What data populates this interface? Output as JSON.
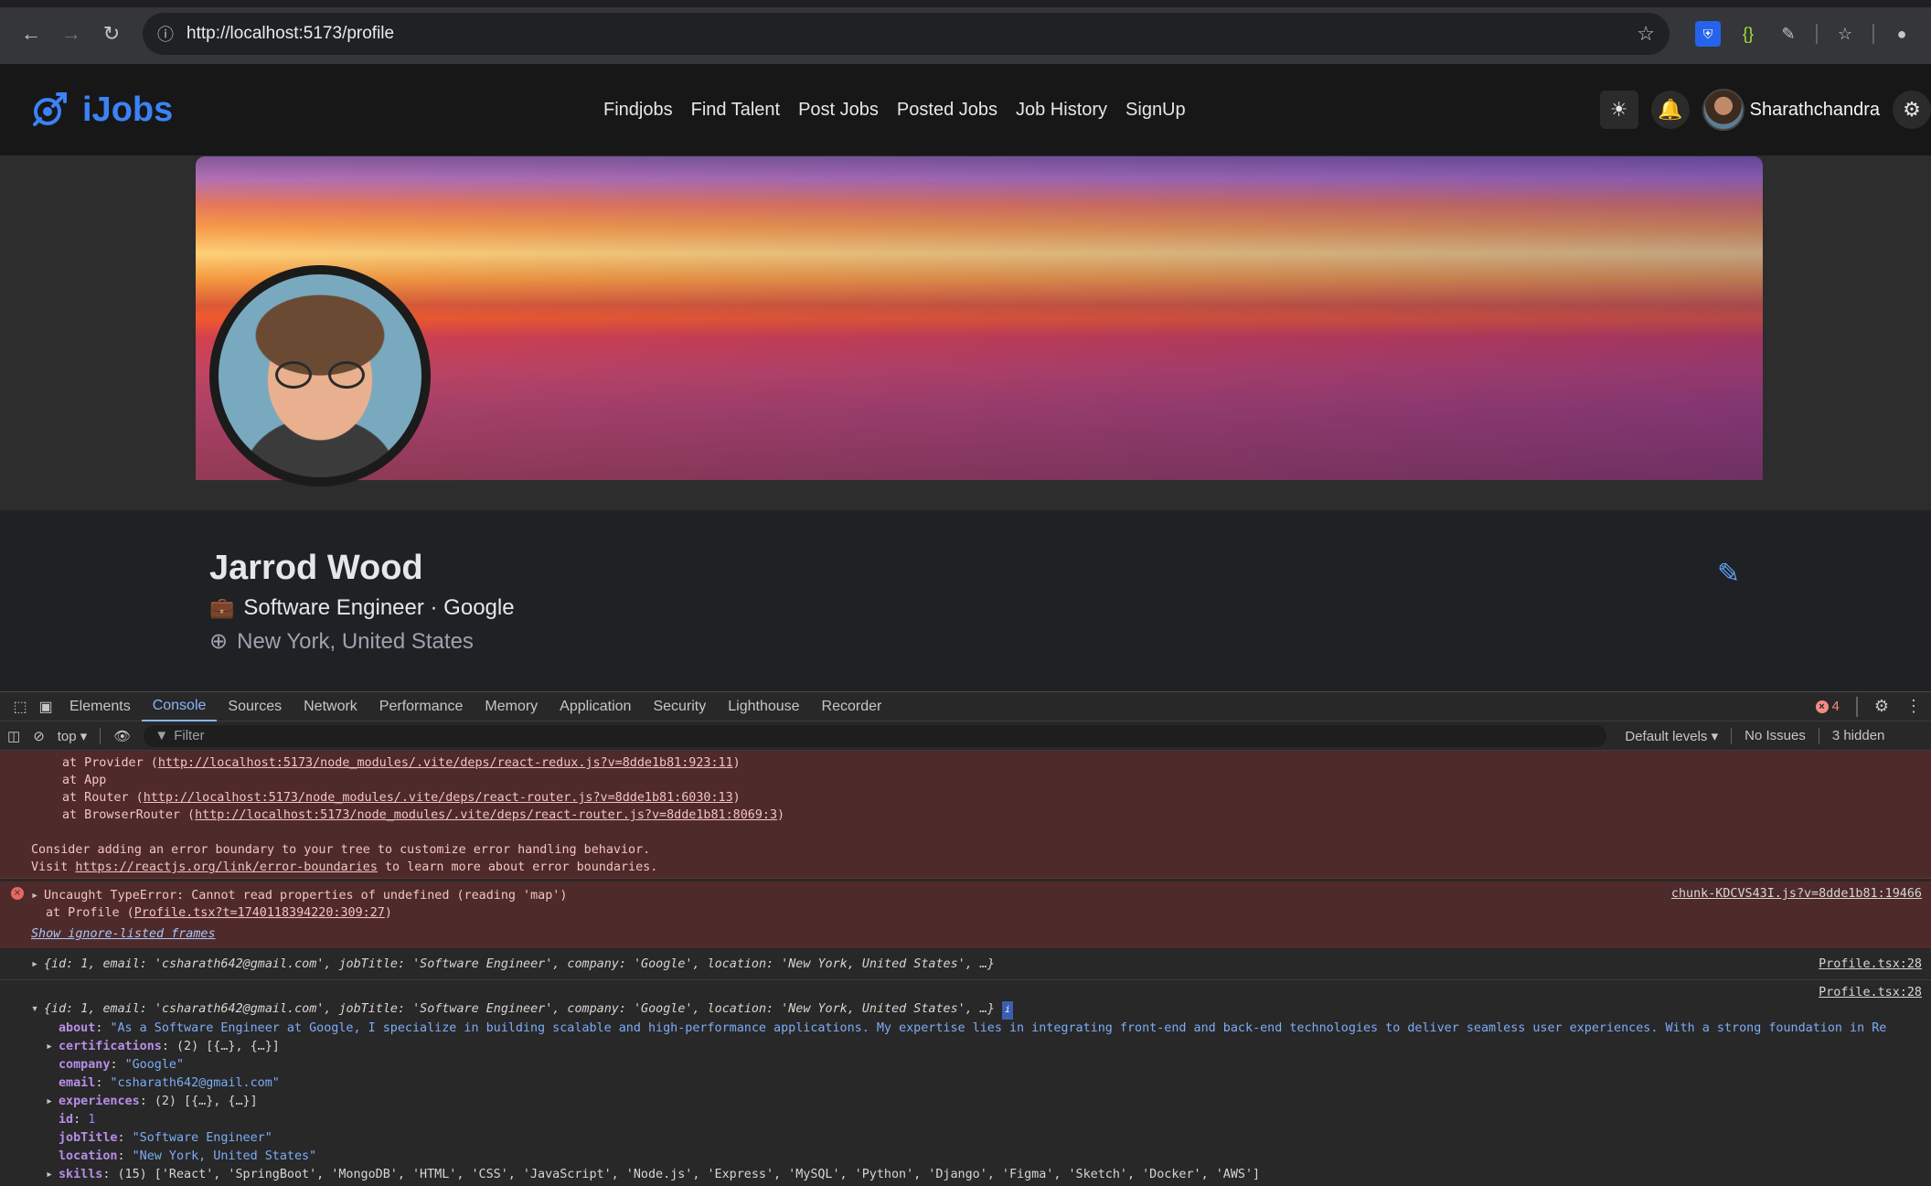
{
  "browser": {
    "url": "http://localhost:5173/profile"
  },
  "header": {
    "brand": "iJobs",
    "nav": [
      "Findjobs",
      "Find Talent",
      "Post Jobs",
      "Posted Jobs",
      "Job History",
      "SignUp"
    ],
    "username": "Sharathchandra"
  },
  "profile": {
    "name": "Jarrod Wood",
    "title_line": "Software Engineer · Google",
    "location": "New York, United States"
  },
  "devtools": {
    "tabs": [
      "Elements",
      "Console",
      "Sources",
      "Network",
      "Performance",
      "Memory",
      "Application",
      "Security",
      "Lighthouse",
      "Recorder"
    ],
    "active_tab": "Console",
    "error_count": "4",
    "context": "top",
    "filter_placeholder": "Filter",
    "levels": "Default levels",
    "issues": "No Issues",
    "hidden": "3 hidden"
  },
  "console": {
    "stack1": [
      "at Provider (",
      "http://localhost:5173/node_modules/.vite/deps/react-redux.js?v=8dde1b81:923:11",
      "at App",
      "at Router (",
      "http://localhost:5173/node_modules/.vite/deps/react-router.js?v=8dde1b81:6030:13",
      "at BrowserRouter (",
      "http://localhost:5173/node_modules/.vite/deps/react-router.js?v=8dde1b81:8069:3"
    ],
    "consider": "Consider adding an error boundary to your tree to customize error handling behavior.",
    "visit_prefix": "Visit ",
    "visit_link": "https://reactjs.org/link/error-boundaries",
    "visit_suffix": " to learn more about error boundaries.",
    "error2": "Uncaught TypeError: Cannot read properties of undefined (reading 'map')",
    "error2_src": "chunk-KDCVS43I.js?v=8dde1b81:19466",
    "error2_at": "at Profile (",
    "error2_at_link": "Profile.tsx?t=1740118394220:309:27",
    "ignore_frames": "Show ignore-listed frames",
    "log1_src": "Profile.tsx:28",
    "log2_src": "Profile.tsx:28",
    "log_summary_1": "{id: 1, email: 'csharath642@gmail.com', jobTitle: 'Software Engineer', company: 'Google', location: 'New York, United States', …}",
    "log_summary_2": "{id: 1, email: 'csharath642@gmail.com', jobTitle: 'Software Engineer', company: 'Google', location: 'New York, United States', …}",
    "props": [
      {
        "key": "about",
        "value": "\"As a Software Engineer at Google, I specialize in building scalable and high-performance applications. My expertise lies in integrating front-end and back-end technologies to deliver seamless user experiences. With a strong foundation in Re",
        "expandable": false
      },
      {
        "key": "certifications",
        "value": "(2) [{…}, {…}]",
        "expandable": true
      },
      {
        "key": "company",
        "value": "\"Google\"",
        "expandable": false
      },
      {
        "key": "email",
        "value": "\"csharath642@gmail.com\"",
        "expandable": false
      },
      {
        "key": "experiences",
        "value": "(2) [{…}, {…}]",
        "expandable": true
      },
      {
        "key": "id",
        "value": "1",
        "expandable": false
      },
      {
        "key": "jobTitle",
        "value": "\"Software Engineer\"",
        "expandable": false
      },
      {
        "key": "location",
        "value": "\"New York, United States\"",
        "expandable": false
      },
      {
        "key": "skills",
        "value": "(15) ['React', 'SpringBoot', 'MongoDB', 'HTML', 'CSS', 'JavaScript', 'Node.js', 'Express', 'MySQL', 'Python', 'Django', 'Figma', 'Sketch', 'Docker', 'AWS']",
        "expandable": true
      }
    ]
  }
}
